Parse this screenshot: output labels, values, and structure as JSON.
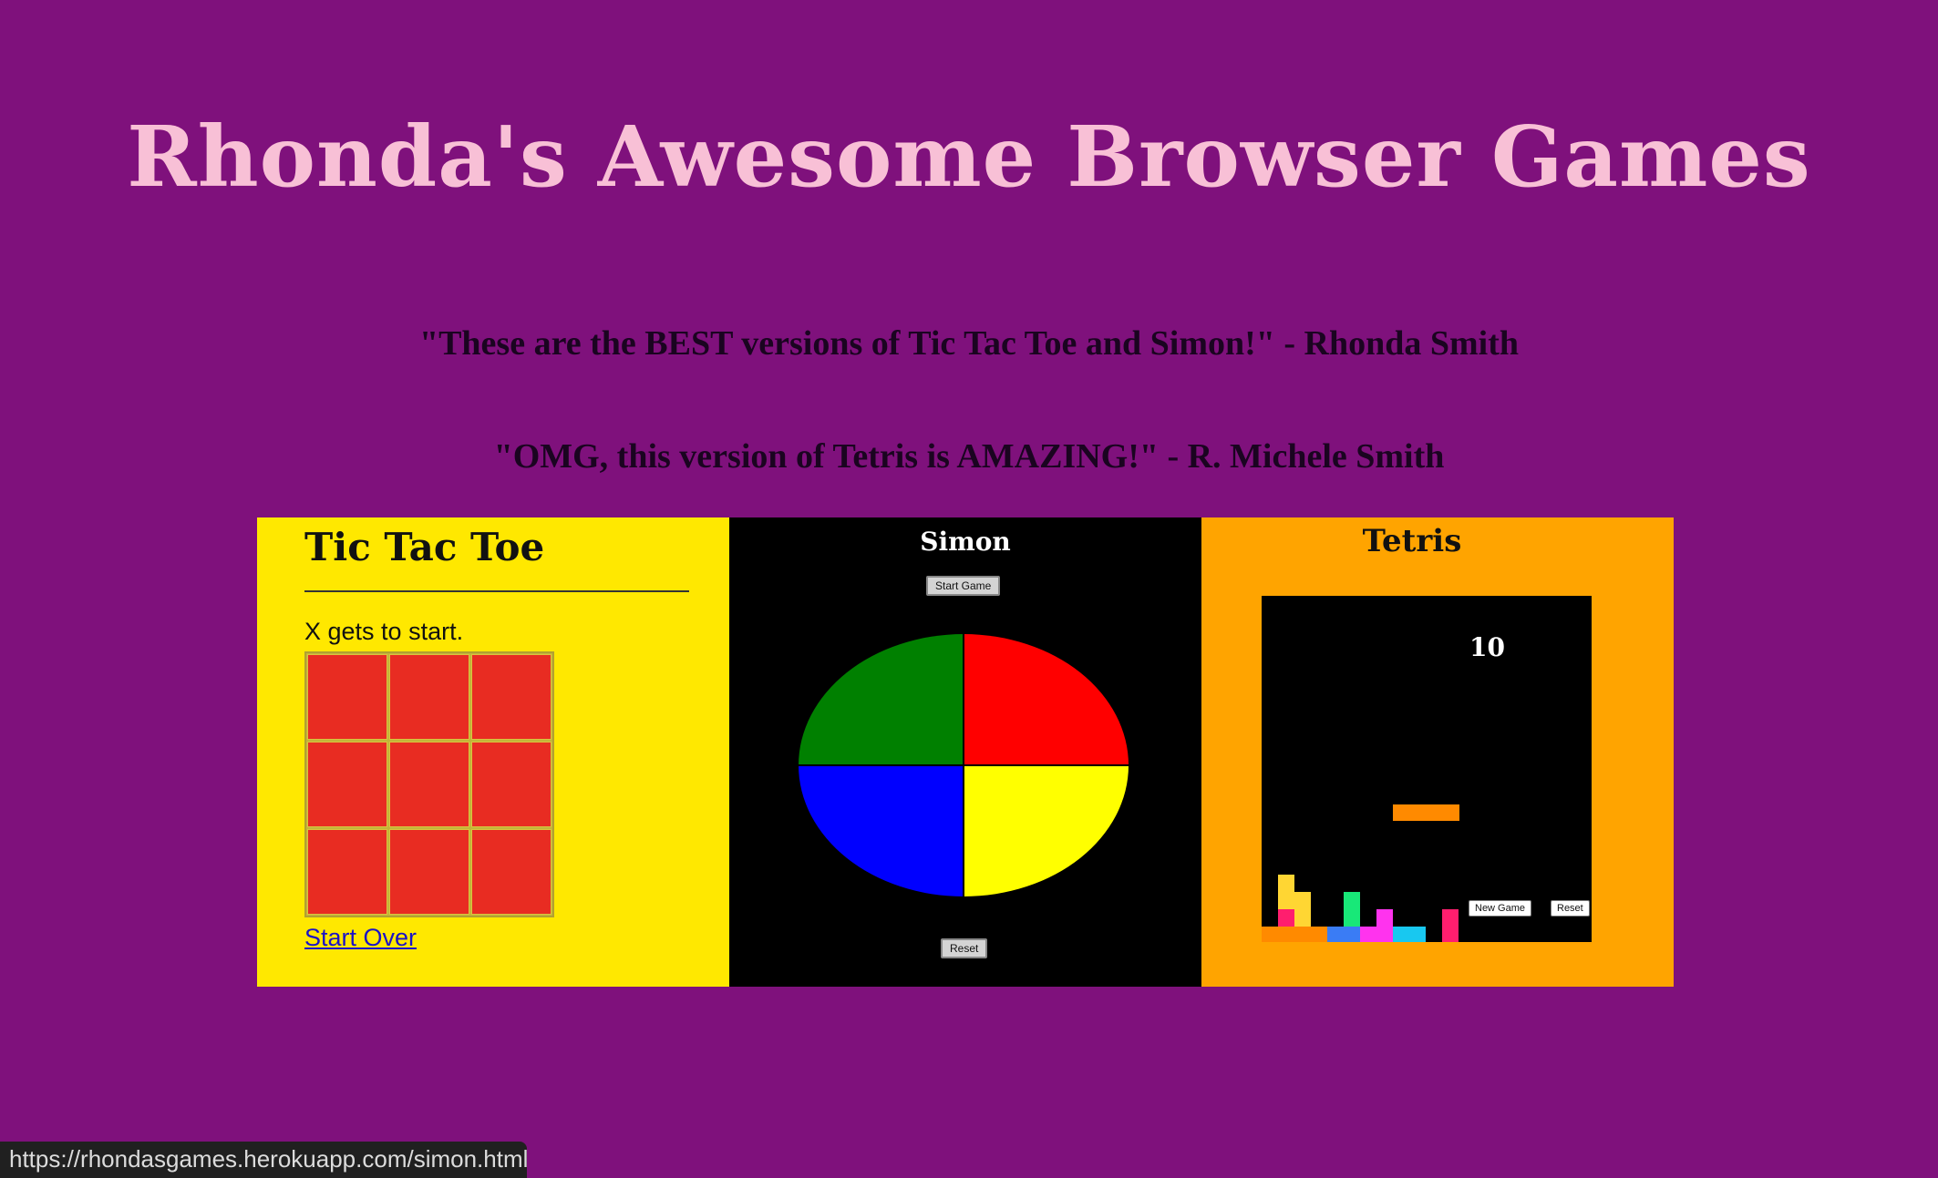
{
  "page": {
    "title": "Rhonda's Awesome Browser Games",
    "quotes": [
      "\"These are the BEST versions of Tic Tac Toe and Simon!\" - Rhonda Smith",
      "\"OMG, this version of Tetris is AMAZING!\" - R. Michele Smith"
    ]
  },
  "tic_tac_toe": {
    "title": "Tic Tac Toe",
    "status": "X gets to start.",
    "start_over": "Start Over"
  },
  "simon": {
    "title": "Simon",
    "start_button": "Start Game",
    "reset_button": "Reset"
  },
  "tetris": {
    "title": "Tetris",
    "score": "10",
    "new_game_button": "New Game",
    "reset_button": "Reset"
  },
  "status_bar": {
    "url": "https://rhondasgames.herokuapp.com/simon.html"
  },
  "colors": {
    "background": "#7f117c",
    "title": "#f8c0d6",
    "ttt_panel": "#ffe800",
    "ttt_cell": "#e82c22",
    "tetris_panel": "#ffa400",
    "simon_green": "#008000",
    "simon_red": "#ff0000",
    "simon_blue": "#0000ff",
    "simon_yellow": "#ffff00"
  }
}
